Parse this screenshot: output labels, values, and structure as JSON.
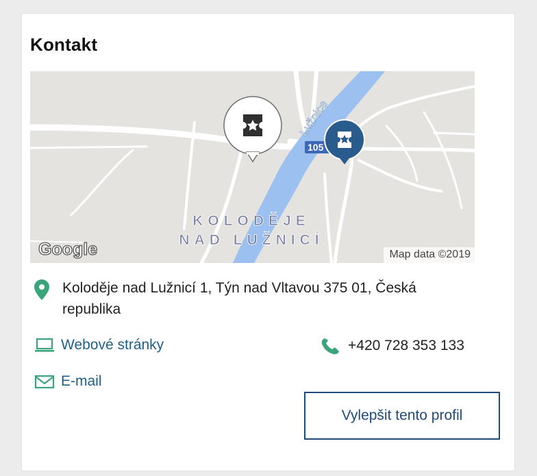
{
  "contact": {
    "title": "Kontakt",
    "address": "Koloděje nad Lužnicí 1, Týn nad Vltavou 375 01, Česká republika",
    "website_label": "Webové stránky",
    "email_label": "E-mail",
    "phone": "+420 728 353 133",
    "improve_button_label": "Vylepšit tento profil"
  },
  "map": {
    "river_label": "Lužnice",
    "road_number": "105",
    "place_label_line1": "KOLODĚJE",
    "place_label_line2": "NAD LUŽNICÍ",
    "attribution": "Map data ©2019",
    "logo_text": "Google"
  },
  "colors": {
    "accent_green": "#3aa57a",
    "link_blue": "#1e5f8a",
    "button_border": "#1f4a7a",
    "marker_blue": "#2a5b8d",
    "river_blue": "#9cc1f0",
    "map_background": "#e5e3df"
  },
  "icons": {
    "location": "location-pin-icon",
    "website": "laptop-icon",
    "email": "envelope-icon",
    "phone": "phone-icon",
    "map_marker_white": "ticket-marker-icon",
    "map_marker_blue": "ticket-marker-icon"
  }
}
